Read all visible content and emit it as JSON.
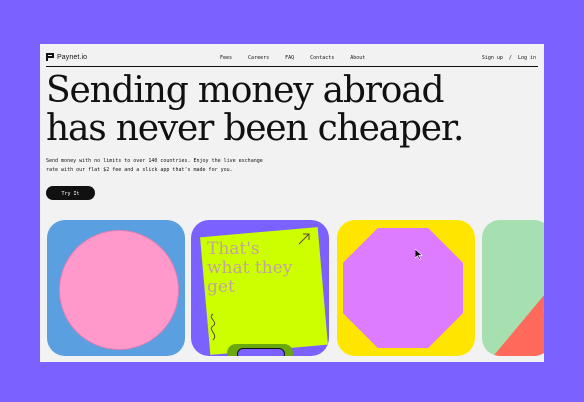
{
  "brand": {
    "name": "Paynet.io"
  },
  "nav": {
    "links": [
      "Fees",
      "Careers",
      "FAQ",
      "Contacts",
      "About"
    ],
    "sign_up": "Sign up",
    "separator": "/",
    "log_in": "Log in"
  },
  "hero": {
    "title_line1": "Sending money abroad",
    "title_line2": "has never been cheaper.",
    "desc_line1": "Send money with no limits to over 140 countries. Enjoy the live exchange",
    "desc_line2": "rate with our flat $2 fee and a slick app that's made for you.",
    "cta": "Try It"
  },
  "cards": {
    "quote_line1": "That's",
    "quote_line2": "what they get"
  },
  "colors": {
    "background": "#7b61ff",
    "page": "#f2f2f2",
    "card_blue": "#5aa0e0",
    "card_yellow": "#ffe600",
    "card_mint": "#a7e0b0",
    "lime": "#ccff00",
    "pink": "#ff99cc",
    "violet": "#dd7cff",
    "coral": "#ff6a5a"
  },
  "icons": [
    "paynet-logo-icon",
    "cursor-icon",
    "squiggle-icon"
  ]
}
